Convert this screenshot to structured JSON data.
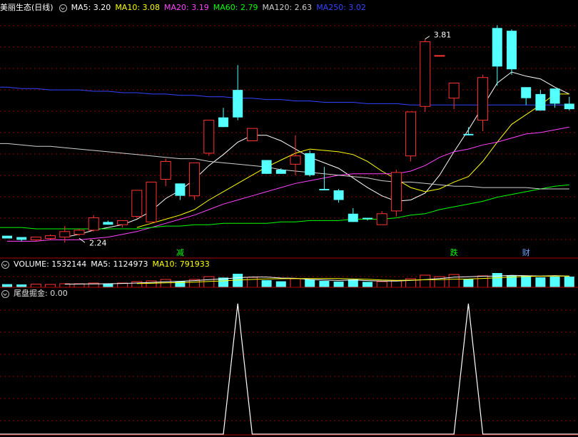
{
  "header_main": {
    "title": "美丽生态(日线)",
    "items": [
      {
        "label": "MA5: 3.20",
        "color": "#ffffff"
      },
      {
        "label": "MA10: 3.08",
        "color": "#ffff00"
      },
      {
        "label": "MA20: 3.19",
        "color": "#ff44ff"
      },
      {
        "label": "MA60: 2.79",
        "color": "#00ff00"
      },
      {
        "label": "MA120: 2.63",
        "color": "#d0d0d0"
      },
      {
        "label": "MA250: 3.02",
        "color": "#3344ff"
      }
    ]
  },
  "header_volume": {
    "items": [
      {
        "label": "VOLUME: 1532144",
        "color": "#ffffff"
      },
      {
        "label": "MA5: 1124973",
        "color": "#ffffff"
      },
      {
        "label": "MA10: 791933",
        "color": "#ffff00"
      }
    ]
  },
  "header_indicator": {
    "title": "尾盘掘金",
    "value": ": 0.00"
  },
  "annotations": {
    "high_label": "3.81",
    "low_label": "2.24",
    "events": [
      "减",
      "跌",
      "财"
    ]
  },
  "colors": {
    "up": "#ff3333",
    "down": "#54ffff",
    "grid": "#8b0000",
    "event_green": "#00ff00",
    "event_blue": "#6fa8ff"
  },
  "chart_data": [
    {
      "type": "candlestick",
      "title": "美丽生态(日线)",
      "ylim": [
        2.2,
        3.9
      ],
      "candles": [
        [
          2.29,
          2.29,
          2.27,
          2.27
        ],
        [
          2.28,
          2.28,
          2.25,
          2.26
        ],
        [
          2.26,
          2.28,
          2.25,
          2.28
        ],
        [
          2.27,
          2.3,
          2.26,
          2.29
        ],
        [
          2.28,
          2.36,
          2.24,
          2.32
        ],
        [
          2.3,
          2.34,
          2.29,
          2.33
        ],
        [
          2.33,
          2.44,
          2.32,
          2.42
        ],
        [
          2.39,
          2.4,
          2.37,
          2.37
        ],
        [
          2.37,
          2.4,
          2.35,
          2.4
        ],
        [
          2.43,
          2.62,
          2.42,
          2.62
        ],
        [
          2.39,
          2.68,
          2.39,
          2.68
        ],
        [
          2.7,
          2.85,
          2.65,
          2.83
        ],
        [
          2.67,
          2.67,
          2.55,
          2.58
        ],
        [
          2.58,
          2.82,
          2.55,
          2.82
        ],
        [
          2.89,
          3.13,
          2.87,
          3.13
        ],
        [
          3.15,
          3.22,
          3.08,
          3.08
        ],
        [
          3.35,
          3.53,
          3.13,
          3.15
        ],
        [
          2.98,
          3.07,
          2.98,
          3.07
        ],
        [
          2.84,
          2.84,
          2.74,
          2.74
        ],
        [
          2.77,
          2.78,
          2.74,
          2.74
        ],
        [
          2.81,
          3.02,
          2.73,
          2.87
        ],
        [
          2.89,
          2.91,
          2.72,
          2.73
        ],
        [
          2.63,
          2.79,
          2.62,
          2.62
        ],
        [
          2.62,
          2.63,
          2.53,
          2.55
        ],
        [
          2.45,
          2.49,
          2.39,
          2.39
        ],
        [
          2.42,
          2.42,
          2.4,
          2.41
        ],
        [
          2.37,
          2.47,
          2.37,
          2.45
        ],
        [
          2.47,
          2.77,
          2.43,
          2.75
        ],
        [
          2.87,
          3.19,
          2.83,
          3.19
        ],
        [
          3.23,
          3.72,
          3.19,
          3.7
        ],
        [
          3.6,
          3.6,
          3.6,
          3.6
        ],
        [
          3.29,
          3.4,
          3.21,
          3.4
        ],
        [
          3.03,
          3.08,
          3.02,
          3.02
        ],
        [
          3.13,
          3.46,
          3.05,
          3.44
        ],
        [
          3.8,
          3.82,
          3.38,
          3.52
        ],
        [
          3.78,
          3.79,
          3.46,
          3.5
        ],
        [
          3.37,
          3.33,
          3.24,
          3.29
        ],
        [
          3.32,
          3.35,
          3.2,
          3.2
        ],
        [
          3.36,
          3.31,
          3.22,
          3.25
        ],
        [
          3.25,
          3.3,
          3.2,
          3.21
        ]
      ],
      "ma": [
        {
          "name": "MA5",
          "values": [
            null,
            null,
            null,
            null,
            2.28,
            2.3,
            2.33,
            2.35,
            2.37,
            2.41,
            2.47,
            2.56,
            2.62,
            2.7,
            2.8,
            2.88,
            2.97,
            3.02,
            3.02,
            2.98,
            2.92,
            2.86,
            2.82,
            2.78,
            2.71,
            2.64,
            2.58,
            2.54,
            2.55,
            2.6,
            2.73,
            2.9,
            3.06,
            3.23,
            3.4,
            3.48,
            3.45,
            3.43,
            3.37,
            3.32
          ]
        },
        {
          "name": "MA10",
          "values": [
            null,
            null,
            null,
            null,
            null,
            null,
            null,
            null,
            null,
            2.35,
            2.38,
            2.41,
            2.44,
            2.48,
            2.55,
            2.61,
            2.67,
            2.73,
            2.79,
            2.84,
            2.89,
            2.92,
            2.91,
            2.9,
            2.88,
            2.83,
            2.76,
            2.7,
            2.64,
            2.61,
            2.63,
            2.68,
            2.72,
            2.83,
            2.97,
            3.1,
            3.17,
            3.24,
            3.32,
            3.32
          ]
        },
        {
          "name": "MA20",
          "values": [
            2.25,
            2.25,
            2.25,
            2.26,
            2.26,
            2.26,
            2.27,
            2.28,
            2.3,
            2.32,
            2.35,
            2.38,
            2.41,
            2.44,
            2.48,
            2.52,
            2.55,
            2.58,
            2.61,
            2.64,
            2.67,
            2.69,
            2.71,
            2.73,
            2.74,
            2.74,
            2.74,
            2.74,
            2.76,
            2.8,
            2.86,
            2.9,
            2.92,
            2.95,
            2.97,
            3.0,
            3.03,
            3.04,
            3.06,
            3.08
          ]
        },
        {
          "name": "MA60",
          "values": [
            2.35,
            2.35,
            2.34,
            2.34,
            2.34,
            2.34,
            2.34,
            2.34,
            2.34,
            2.34,
            2.35,
            2.36,
            2.36,
            2.37,
            2.37,
            2.38,
            2.38,
            2.38,
            2.38,
            2.39,
            2.39,
            2.4,
            2.4,
            2.4,
            2.41,
            2.41,
            2.41,
            2.42,
            2.44,
            2.45,
            2.48,
            2.5,
            2.52,
            2.54,
            2.57,
            2.59,
            2.61,
            2.63,
            2.65,
            2.66
          ]
        },
        {
          "name": "MA120",
          "values": [
            2.96,
            2.95,
            2.94,
            2.94,
            2.93,
            2.92,
            2.91,
            2.9,
            2.89,
            2.88,
            2.87,
            2.86,
            2.85,
            2.85,
            2.83,
            2.82,
            2.81,
            2.8,
            2.79,
            2.77,
            2.76,
            2.75,
            2.74,
            2.73,
            2.72,
            2.71,
            2.69,
            2.68,
            2.68,
            2.67,
            2.66,
            2.65,
            2.65,
            2.64,
            2.64,
            2.64,
            2.64,
            2.63,
            2.63,
            2.63
          ]
        },
        {
          "name": "MA250",
          "values": [
            3.37,
            3.36,
            3.36,
            3.35,
            3.35,
            3.35,
            3.34,
            3.34,
            3.33,
            3.33,
            3.32,
            3.32,
            3.31,
            3.31,
            3.3,
            3.3,
            3.29,
            3.29,
            3.28,
            3.28,
            3.27,
            3.27,
            3.26,
            3.26,
            3.26,
            3.25,
            3.25,
            3.25,
            3.24,
            3.24,
            3.24,
            3.24,
            3.24,
            3.24,
            3.24,
            3.24,
            3.24,
            3.24,
            3.24,
            3.24
          ]
        }
      ],
      "events": [
        {
          "index": 12,
          "label": "减"
        },
        {
          "index": 31,
          "label": "跌"
        },
        {
          "index": 36,
          "label": "财"
        }
      ]
    },
    {
      "type": "bar",
      "title": "VOLUME",
      "values": [
        0.22,
        0.2,
        0.22,
        0.2,
        0.25,
        0.25,
        0.3,
        0.25,
        0.3,
        0.4,
        0.45,
        0.55,
        0.42,
        0.55,
        0.75,
        0.68,
        0.95,
        0.7,
        0.5,
        0.42,
        0.6,
        0.55,
        0.45,
        0.4,
        0.55,
        0.38,
        0.4,
        0.45,
        0.6,
        0.85,
        0.75,
        0.9,
        0.6,
        0.8,
        1.0,
        0.85,
        0.8,
        0.7,
        0.75,
        0.75
      ],
      "ma5": [
        null,
        null,
        null,
        null,
        0.22,
        0.23,
        0.24,
        0.25,
        0.27,
        0.3,
        0.34,
        0.39,
        0.42,
        0.47,
        0.54,
        0.59,
        0.67,
        0.72,
        0.72,
        0.65,
        0.63,
        0.55,
        0.51,
        0.48,
        0.51,
        0.47,
        0.44,
        0.44,
        0.48,
        0.54,
        0.61,
        0.71,
        0.74,
        0.78,
        0.79,
        0.84,
        0.81,
        0.79,
        0.82,
        0.78
      ],
      "ma10": [
        null,
        null,
        null,
        null,
        null,
        null,
        null,
        null,
        null,
        0.26,
        0.28,
        0.31,
        0.33,
        0.36,
        0.41,
        0.45,
        0.51,
        0.55,
        0.59,
        0.6,
        0.61,
        0.61,
        0.62,
        0.61,
        0.59,
        0.56,
        0.51,
        0.49,
        0.5,
        0.53,
        0.54,
        0.57,
        0.58,
        0.62,
        0.67,
        0.72,
        0.76,
        0.78,
        0.79,
        0.79
      ]
    },
    {
      "type": "line",
      "title": "尾盘掘金",
      "ylim": [
        0,
        1
      ],
      "values": [
        0,
        0,
        0,
        0,
        0,
        0,
        0,
        0,
        0,
        0,
        0,
        0,
        0,
        0,
        0,
        0,
        1,
        0,
        0,
        0,
        0,
        0,
        0,
        0,
        0,
        0,
        0,
        0,
        0,
        0,
        0,
        0,
        1,
        0,
        0,
        0,
        0,
        0,
        0,
        0
      ]
    }
  ]
}
